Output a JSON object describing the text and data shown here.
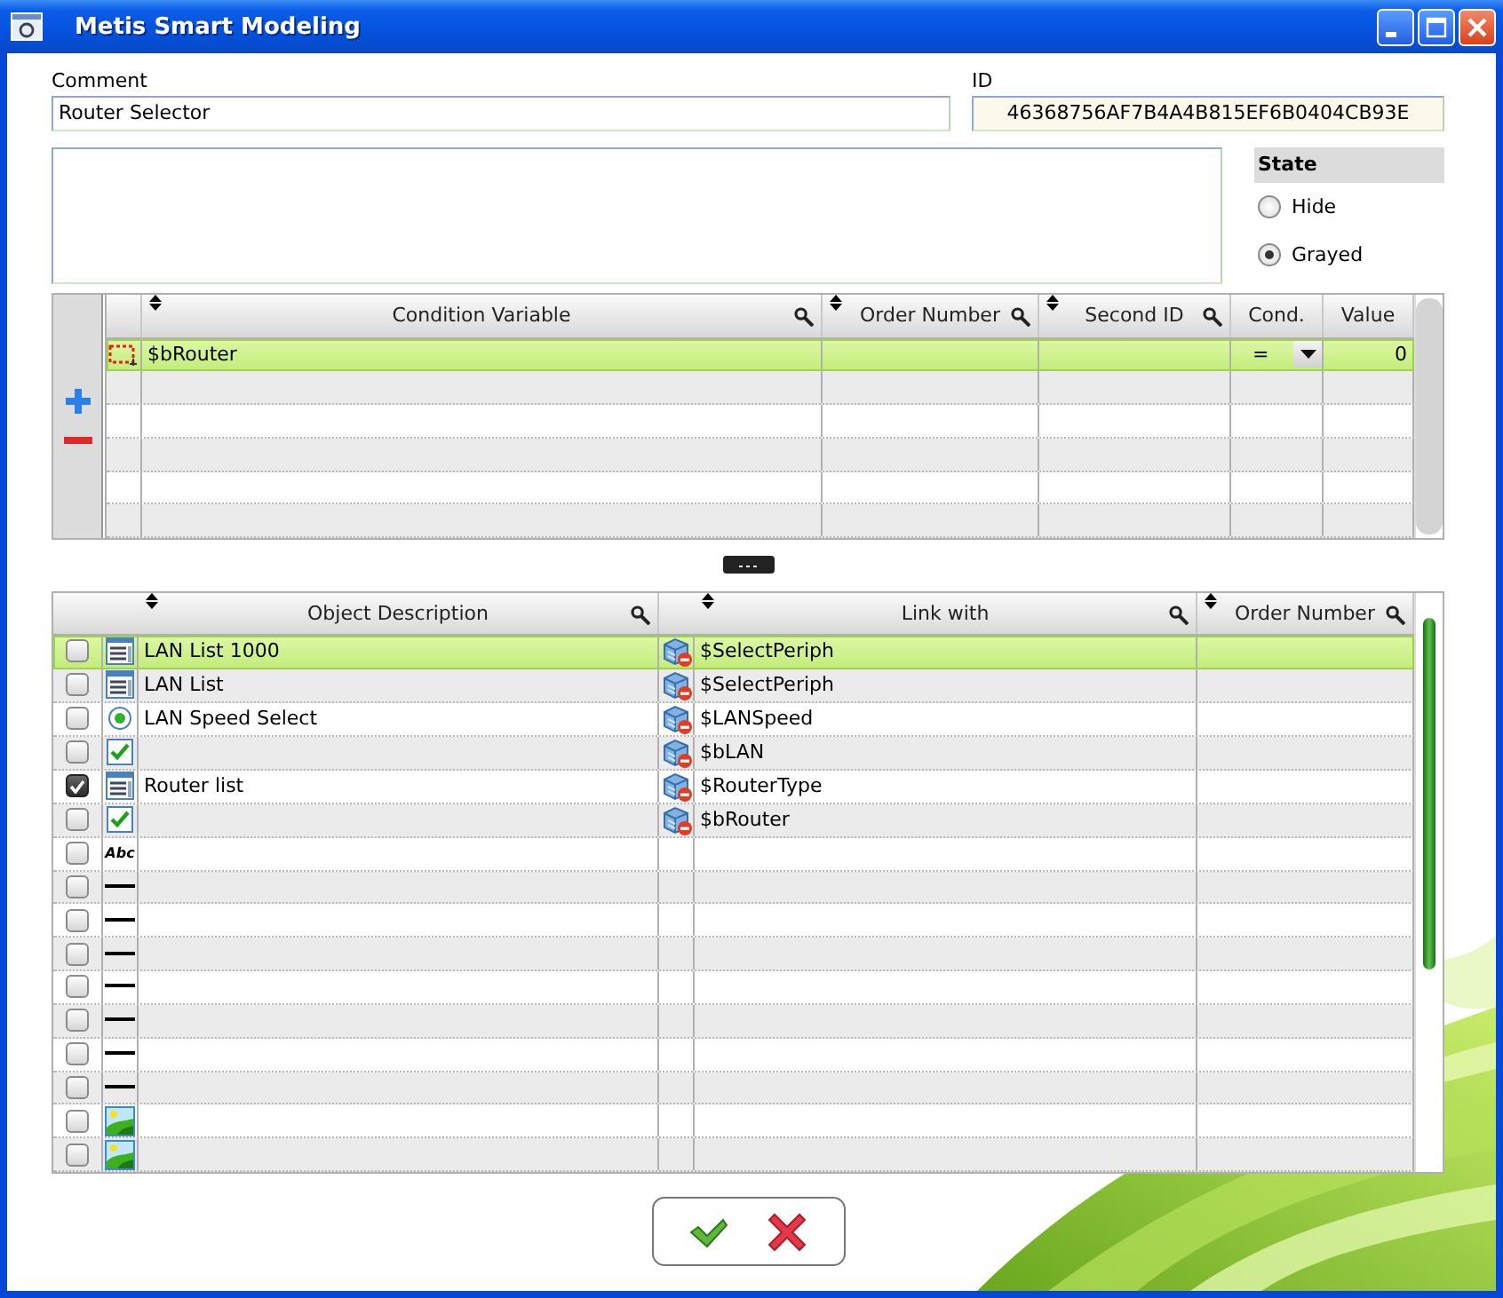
{
  "window": {
    "title": "Metis Smart Modeling"
  },
  "comment": {
    "label": "Comment",
    "value": "Router Selector"
  },
  "id": {
    "label": "ID",
    "value": "46368756AF7B4A4B815EF6B0404CB93E"
  },
  "state": {
    "title": "State",
    "options": [
      {
        "label": "Hide",
        "selected": false
      },
      {
        "label": "Grayed",
        "selected": true
      }
    ]
  },
  "conditions": {
    "columns": [
      {
        "label": "Condition Variable",
        "sortable": true,
        "filter": true
      },
      {
        "label": "Order Number",
        "sortable": true,
        "filter": true
      },
      {
        "label": "Second ID",
        "sortable": true,
        "filter": true
      },
      {
        "label": "Cond.",
        "sortable": false,
        "filter": false
      },
      {
        "label": "Value",
        "sortable": false,
        "filter": false
      }
    ],
    "rows": [
      {
        "variable": "$bRouter",
        "cond": "=",
        "value": "0",
        "selected": true
      }
    ]
  },
  "objects": {
    "columns": [
      {
        "label": "Object Description",
        "sortable": true,
        "filter": true
      },
      {
        "label": "Link with",
        "sortable": true,
        "filter": true
      },
      {
        "label": "Order Number",
        "sortable": true,
        "filter": true
      }
    ],
    "rows": [
      {
        "checked": false,
        "kind": "list",
        "description": "LAN List 1000",
        "link": "$SelectPeriph",
        "selected": true
      },
      {
        "checked": false,
        "kind": "list",
        "description": "LAN List",
        "link": "$SelectPeriph",
        "selected": false
      },
      {
        "checked": false,
        "kind": "radio",
        "description": "LAN Speed Select",
        "link": "$LANSpeed",
        "selected": false
      },
      {
        "checked": false,
        "kind": "checkbox",
        "link": "$bLAN",
        "selected": false
      },
      {
        "checked": true,
        "kind": "list",
        "description": "Router list",
        "link": "$RouterType",
        "selected": false
      },
      {
        "checked": false,
        "kind": "checkbox",
        "link": "$bRouter",
        "selected": false
      },
      {
        "checked": false,
        "kind": "label",
        "icon_text": "Abc",
        "selected": false
      },
      {
        "checked": false,
        "kind": "line",
        "selected": false
      },
      {
        "checked": false,
        "kind": "line",
        "selected": false
      },
      {
        "checked": false,
        "kind": "line",
        "selected": false
      },
      {
        "checked": false,
        "kind": "line",
        "selected": false
      },
      {
        "checked": false,
        "kind": "line",
        "selected": false
      },
      {
        "checked": false,
        "kind": "line",
        "selected": false
      },
      {
        "checked": false,
        "kind": "line",
        "selected": false
      },
      {
        "checked": false,
        "kind": "image",
        "selected": false
      },
      {
        "checked": false,
        "kind": "image",
        "selected": false
      }
    ]
  }
}
